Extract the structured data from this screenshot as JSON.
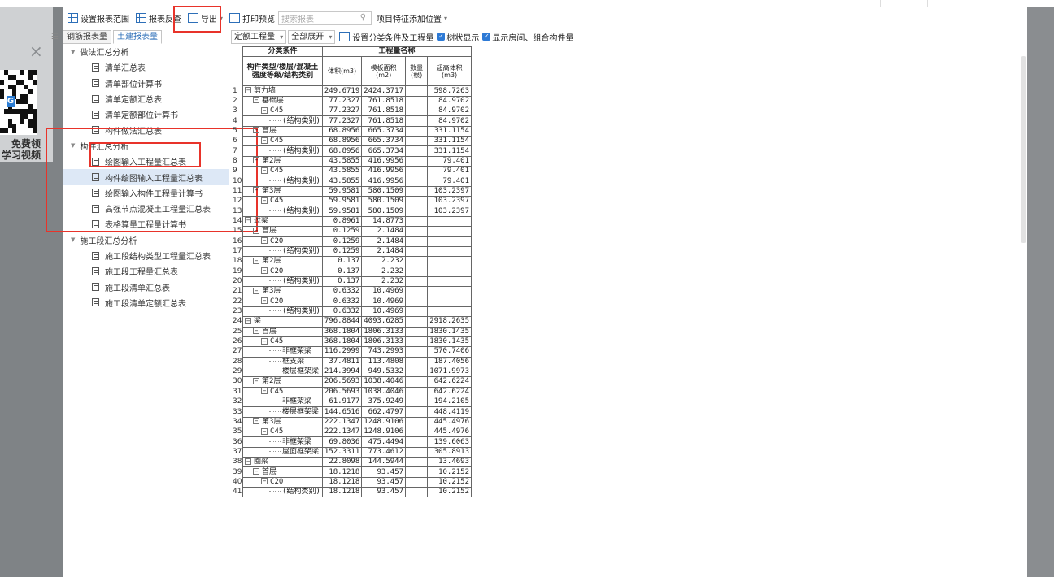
{
  "overlay": {
    "close_glyph": "×",
    "promo_line1": "免费领",
    "promo_line2": "学习视频"
  },
  "toolbar": {
    "set_range": "设置报表范围",
    "report_reverse": "报表反查",
    "export": "导出",
    "print_preview": "打印预览",
    "search_placeholder": "搜索报表",
    "feature_position": "项目特征添加位置"
  },
  "tabs": {
    "steel": "钢筋报表量",
    "civil": "土建报表量"
  },
  "tree": {
    "group1": "做法汇总分析",
    "group1_items": [
      "清单汇总表",
      "清单部位计算书",
      "清单定额汇总表",
      "清单定额部位计算书",
      "构件做法汇总表"
    ],
    "group2": "构件汇总分析",
    "group2_items": [
      "绘图输入工程量汇总表",
      "构件绘图输入工程量汇总表",
      "绘图输入构件工程量计算书",
      "高强节点混凝土工程量汇总表",
      "表格算量工程量计算书"
    ],
    "group3": "施工段汇总分析",
    "group3_items": [
      "施工段结构类型工程量汇总表",
      "施工段工程量汇总表",
      "施工段清单汇总表",
      "施工段清单定额汇总表"
    ]
  },
  "filters": {
    "quota_qty": "定额工程量",
    "expand_all": "全部展开",
    "set_class": "设置分类条件及工程量",
    "tree_display": "树状显示",
    "show_rooms": "显示房间、组合构件量"
  },
  "table": {
    "header_class": "分类条件",
    "header_qty": "工程量名称",
    "col_type": "构件类型/楼层/混凝土强度等级/结构类别",
    "col_volume": "体积(m3)",
    "col_formwork": "模板面积(m2)",
    "col_count": "数量(根)",
    "col_overheight": "超高体积(m3)",
    "rows": [
      {
        "n": "1",
        "lvl": 0,
        "tog": "−",
        "name": "剪力墙",
        "v": "249.6719",
        "f": "2424.3717",
        "c": "",
        "o": "598.7263"
      },
      {
        "n": "2",
        "lvl": 1,
        "tog": "−",
        "name": "基础层",
        "v": "77.2327",
        "f": "761.8518",
        "c": "",
        "o": "84.9702"
      },
      {
        "n": "3",
        "lvl": 2,
        "tog": "−",
        "name": "C45",
        "v": "77.2327",
        "f": "761.8518",
        "c": "",
        "o": "84.9702"
      },
      {
        "n": "4",
        "lvl": 3,
        "tog": "",
        "name": "(结构类别)",
        "v": "77.2327",
        "f": "761.8518",
        "c": "",
        "o": "84.9702"
      },
      {
        "n": "5",
        "lvl": 1,
        "tog": "−",
        "name": "首层",
        "v": "68.8956",
        "f": "665.3734",
        "c": "",
        "o": "331.1154"
      },
      {
        "n": "6",
        "lvl": 2,
        "tog": "−",
        "name": "C45",
        "v": "68.8956",
        "f": "665.3734",
        "c": "",
        "o": "331.1154"
      },
      {
        "n": "7",
        "lvl": 3,
        "tog": "",
        "name": "(结构类别)",
        "v": "68.8956",
        "f": "665.3734",
        "c": "",
        "o": "331.1154"
      },
      {
        "n": "8",
        "lvl": 1,
        "tog": "−",
        "name": "第2层",
        "v": "43.5855",
        "f": "416.9956",
        "c": "",
        "o": "79.401"
      },
      {
        "n": "9",
        "lvl": 2,
        "tog": "−",
        "name": "C45",
        "v": "43.5855",
        "f": "416.9956",
        "c": "",
        "o": "79.401"
      },
      {
        "n": "10",
        "lvl": 3,
        "tog": "",
        "name": "(结构类别)",
        "v": "43.5855",
        "f": "416.9956",
        "c": "",
        "o": "79.401"
      },
      {
        "n": "11",
        "lvl": 1,
        "tog": "−",
        "name": "第3层",
        "v": "59.9581",
        "f": "580.1509",
        "c": "",
        "o": "103.2397"
      },
      {
        "n": "12",
        "lvl": 2,
        "tog": "−",
        "name": "C45",
        "v": "59.9581",
        "f": "580.1509",
        "c": "",
        "o": "103.2397"
      },
      {
        "n": "13",
        "lvl": 3,
        "tog": "",
        "name": "(结构类别)",
        "v": "59.9581",
        "f": "580.1509",
        "c": "",
        "o": "103.2397"
      },
      {
        "n": "14",
        "lvl": 0,
        "tog": "−",
        "name": "过梁",
        "v": "0.8961",
        "f": "14.8773",
        "c": "",
        "o": ""
      },
      {
        "n": "15",
        "lvl": 1,
        "tog": "−",
        "name": "首层",
        "v": "0.1259",
        "f": "2.1484",
        "c": "",
        "o": ""
      },
      {
        "n": "16",
        "lvl": 2,
        "tog": "−",
        "name": "C20",
        "v": "0.1259",
        "f": "2.1484",
        "c": "",
        "o": ""
      },
      {
        "n": "17",
        "lvl": 3,
        "tog": "",
        "name": "(结构类别)",
        "v": "0.1259",
        "f": "2.1484",
        "c": "",
        "o": ""
      },
      {
        "n": "18",
        "lvl": 1,
        "tog": "−",
        "name": "第2层",
        "v": "0.137",
        "f": "2.232",
        "c": "",
        "o": ""
      },
      {
        "n": "19",
        "lvl": 2,
        "tog": "−",
        "name": "C20",
        "v": "0.137",
        "f": "2.232",
        "c": "",
        "o": ""
      },
      {
        "n": "20",
        "lvl": 3,
        "tog": "",
        "name": "(结构类别)",
        "v": "0.137",
        "f": "2.232",
        "c": "",
        "o": ""
      },
      {
        "n": "21",
        "lvl": 1,
        "tog": "−",
        "name": "第3层",
        "v": "0.6332",
        "f": "10.4969",
        "c": "",
        "o": ""
      },
      {
        "n": "22",
        "lvl": 2,
        "tog": "−",
        "name": "C20",
        "v": "0.6332",
        "f": "10.4969",
        "c": "",
        "o": ""
      },
      {
        "n": "23",
        "lvl": 3,
        "tog": "",
        "name": "(结构类别)",
        "v": "0.6332",
        "f": "10.4969",
        "c": "",
        "o": ""
      },
      {
        "n": "24",
        "lvl": 0,
        "tog": "−",
        "name": "梁",
        "v": "796.8844",
        "f": "4093.6285",
        "c": "",
        "o": "2918.2635"
      },
      {
        "n": "25",
        "lvl": 1,
        "tog": "−",
        "name": "首层",
        "v": "368.1804",
        "f": "1806.3133",
        "c": "",
        "o": "1830.1435"
      },
      {
        "n": "26",
        "lvl": 2,
        "tog": "−",
        "name": "C45",
        "v": "368.1804",
        "f": "1806.3133",
        "c": "",
        "o": "1830.1435"
      },
      {
        "n": "27",
        "lvl": 3,
        "tog": "",
        "name": "非框架梁",
        "v": "116.2999",
        "f": "743.2993",
        "c": "",
        "o": "570.7406"
      },
      {
        "n": "28",
        "lvl": 3,
        "tog": "",
        "name": "框支梁",
        "v": "37.4811",
        "f": "113.4808",
        "c": "",
        "o": "187.4056"
      },
      {
        "n": "29",
        "lvl": 3,
        "tog": "",
        "name": "楼层框架梁",
        "v": "214.3994",
        "f": "949.5332",
        "c": "",
        "o": "1071.9973"
      },
      {
        "n": "30",
        "lvl": 1,
        "tog": "−",
        "name": "第2层",
        "v": "206.5693",
        "f": "1038.4046",
        "c": "",
        "o": "642.6224"
      },
      {
        "n": "31",
        "lvl": 2,
        "tog": "−",
        "name": "C45",
        "v": "206.5693",
        "f": "1038.4046",
        "c": "",
        "o": "642.6224"
      },
      {
        "n": "32",
        "lvl": 3,
        "tog": "",
        "name": "非框架梁",
        "v": "61.9177",
        "f": "375.9249",
        "c": "",
        "o": "194.2105"
      },
      {
        "n": "33",
        "lvl": 3,
        "tog": "",
        "name": "楼层框架梁",
        "v": "144.6516",
        "f": "662.4797",
        "c": "",
        "o": "448.4119"
      },
      {
        "n": "34",
        "lvl": 1,
        "tog": "−",
        "name": "第3层",
        "v": "222.1347",
        "f": "1248.9106",
        "c": "",
        "o": "445.4976"
      },
      {
        "n": "35",
        "lvl": 2,
        "tog": "−",
        "name": "C45",
        "v": "222.1347",
        "f": "1248.9106",
        "c": "",
        "o": "445.4976"
      },
      {
        "n": "36",
        "lvl": 3,
        "tog": "",
        "name": "非框架梁",
        "v": "69.8036",
        "f": "475.4494",
        "c": "",
        "o": "139.6063"
      },
      {
        "n": "37",
        "lvl": 3,
        "tog": "",
        "name": "屋面框架梁",
        "v": "152.3311",
        "f": "773.4612",
        "c": "",
        "o": "305.8913"
      },
      {
        "n": "38",
        "lvl": 0,
        "tog": "−",
        "name": "圈梁",
        "v": "22.8098",
        "f": "144.5944",
        "c": "",
        "o": "13.4693"
      },
      {
        "n": "39",
        "lvl": 1,
        "tog": "−",
        "name": "首层",
        "v": "18.1218",
        "f": "93.457",
        "c": "",
        "o": "10.2152"
      },
      {
        "n": "40",
        "lvl": 2,
        "tog": "−",
        "name": "C20",
        "v": "18.1218",
        "f": "93.457",
        "c": "",
        "o": "10.2152"
      },
      {
        "n": "41",
        "lvl": 3,
        "tog": "",
        "name": "(结构类别)",
        "v": "18.1218",
        "f": "93.457",
        "c": "",
        "o": "10.2152"
      }
    ]
  },
  "colors": {
    "highlight": "#e8332a",
    "accent": "#2d6fb8",
    "checkbox": "#2d7ad6",
    "selected_row": "#dde8f6"
  }
}
